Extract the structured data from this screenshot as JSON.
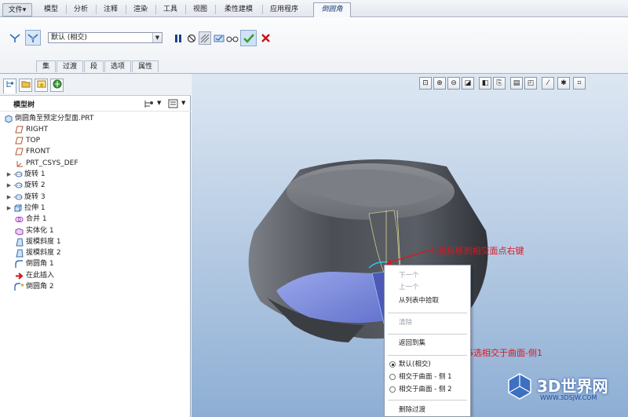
{
  "ribbon_tabs": {
    "file": "文件▾",
    "items": [
      "模型",
      "分析",
      "注释",
      "渲染",
      "工具",
      "视图",
      "柔性建模",
      "应用程序"
    ],
    "active": "倒圆角"
  },
  "ribbon": {
    "set_combo_value": "默认 (相交)",
    "subtabs": [
      "集",
      "过渡",
      "段",
      "选项",
      "属性"
    ],
    "buttons": {
      "pause": "pause-icon",
      "no_preview": "no-preview-icon",
      "preview_geometry": "preview-geometry-icon",
      "verify": "verify-icon",
      "glasses": "glasses-icon",
      "ok": "check-icon",
      "cancel": "cancel-icon"
    },
    "colors": {
      "ok": "#3aa02e",
      "cancel": "#c8121c"
    }
  },
  "model_tree": {
    "title": "模型树",
    "items": [
      {
        "label": "倒圆角至预定分型面.PRT",
        "icon": "part-icon",
        "expandable": false
      },
      {
        "label": "RIGHT",
        "icon": "datum-plane-icon",
        "expandable": false
      },
      {
        "label": "TOP",
        "icon": "datum-plane-icon",
        "expandable": false
      },
      {
        "label": "FRONT",
        "icon": "datum-plane-icon",
        "expandable": false
      },
      {
        "label": "PRT_CSYS_DEF",
        "icon": "csys-icon",
        "expandable": false
      },
      {
        "label": "旋转 1",
        "icon": "revolve-icon",
        "expandable": true
      },
      {
        "label": "旋转 2",
        "icon": "revolve-icon",
        "expandable": true
      },
      {
        "label": "旋转 3",
        "icon": "revolve-icon",
        "expandable": true
      },
      {
        "label": "拉伸 1",
        "icon": "extrude-icon",
        "expandable": true
      },
      {
        "label": "合并 1",
        "icon": "merge-icon",
        "expandable": false
      },
      {
        "label": "实体化 1",
        "icon": "solidify-icon",
        "expandable": false
      },
      {
        "label": "拔模斜度 1",
        "icon": "draft-icon",
        "expandable": false
      },
      {
        "label": "拔模斜度 2",
        "icon": "draft-icon",
        "expandable": false
      },
      {
        "label": "倒圆角 1",
        "icon": "round-icon",
        "expandable": false
      },
      {
        "label": "在此插入",
        "icon": "insert-arrow-icon",
        "expandable": false
      },
      {
        "label": "倒圆角 2",
        "icon": "round-icon",
        "expandable": false
      }
    ]
  },
  "context_menu": {
    "items": [
      {
        "label": "下一个",
        "disabled": true
      },
      {
        "label": "上一个",
        "disabled": true
      },
      {
        "label": "从列表中拾取",
        "disabled": false
      },
      {
        "label": "清除",
        "disabled": true
      },
      {
        "label": "返回到集",
        "disabled": false
      },
      {
        "label": "默认(相交)",
        "radio": true,
        "selected": true
      },
      {
        "label": "相交于曲面 - 侧 1",
        "radio": true,
        "selected": false
      },
      {
        "label": "相交于曲面 - 侧 2",
        "radio": true,
        "selected": false
      },
      {
        "label": "删除过渡",
        "disabled": false
      }
    ]
  },
  "annotations": {
    "step4": "4.鼠标移到相交面点右键",
    "step5": "5选相交于曲面-侧1",
    "color": "#e0141e"
  },
  "watermark": {
    "name": "3D世界网",
    "url": "WWW.3DSJW.COM"
  }
}
